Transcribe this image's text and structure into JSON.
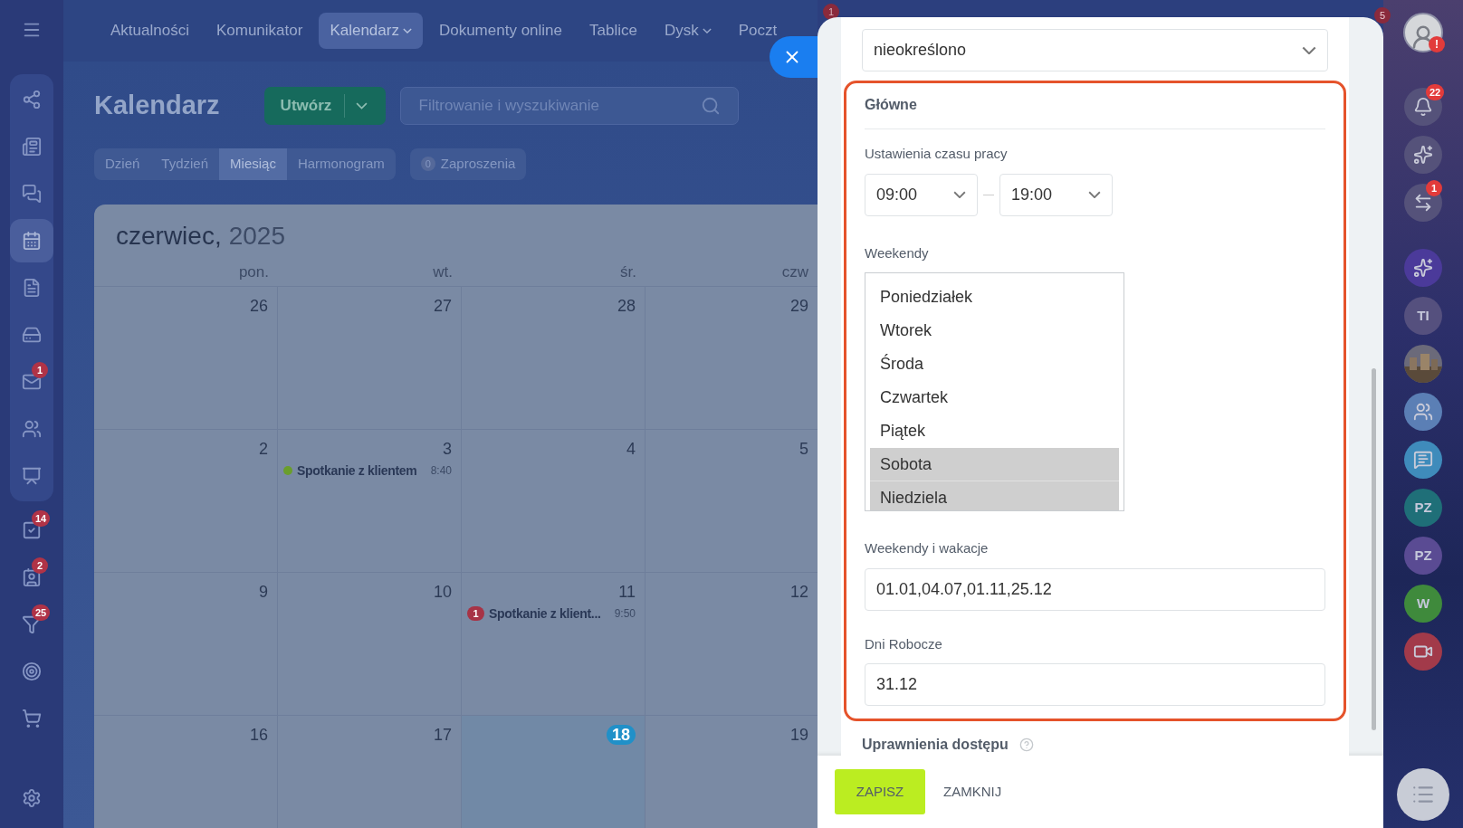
{
  "top_nav": {
    "items": [
      {
        "label": "Aktualności",
        "selected": false,
        "dropdown": false
      },
      {
        "label": "Komunikator",
        "selected": false,
        "dropdown": false
      },
      {
        "label": "Kalendarz",
        "selected": true,
        "dropdown": true
      },
      {
        "label": "Dokumenty online",
        "selected": false,
        "dropdown": false
      },
      {
        "label": "Tablice",
        "selected": false,
        "dropdown": false
      },
      {
        "label": "Dysk",
        "selected": false,
        "dropdown": true
      },
      {
        "label": "Poczt",
        "selected": false,
        "dropdown": false
      }
    ],
    "badges": [
      "1",
      "5"
    ]
  },
  "left_sidebar": {
    "group": [
      {
        "selected": false
      },
      {
        "selected": false
      },
      {
        "selected": false
      },
      {
        "selected": true
      },
      {
        "selected": false
      },
      {
        "selected": false
      },
      {
        "selected": false,
        "badge": "1"
      },
      {
        "selected": false
      },
      {
        "selected": false
      }
    ],
    "items": [
      {
        "selected": false,
        "badge": "14"
      },
      {
        "selected": false,
        "badge": "2"
      },
      {
        "selected": false,
        "badge": "25"
      },
      {
        "selected": false
      },
      {
        "selected": false
      }
    ]
  },
  "page": {
    "title": "Kalendarz",
    "create_button": "Utwórz",
    "search": {
      "placeholder": "Filtrowanie i wyszukiwanie"
    },
    "view_tabs": [
      {
        "label": "Dzień",
        "selected": false
      },
      {
        "label": "Tydzień",
        "selected": false
      },
      {
        "label": "Miesiąc",
        "selected": true
      },
      {
        "label": "Harmonogram",
        "selected": false
      }
    ],
    "invitations": {
      "count": "0",
      "label": "Zaproszenia"
    }
  },
  "calendar": {
    "month": "czerwiec,",
    "year": "2025",
    "weekdays": [
      "pon.",
      "wt.",
      "śr.",
      "czw"
    ],
    "weeks": [
      [
        {
          "day": "26",
          "today": false
        },
        {
          "day": "27",
          "today": false
        },
        {
          "day": "28",
          "today": false
        },
        {
          "day": "29",
          "today": false
        }
      ],
      [
        {
          "day": "2",
          "today": false
        },
        {
          "day": "3",
          "today": false,
          "events": [
            {
              "kind": "dot",
              "color": "#6a9e2c",
              "title": "Spotkanie z klientem",
              "time": "8:40"
            }
          ]
        },
        {
          "day": "4",
          "today": false
        },
        {
          "day": "5",
          "today": false
        }
      ],
      [
        {
          "day": "9",
          "today": false
        },
        {
          "day": "10",
          "today": false
        },
        {
          "day": "11",
          "today": false,
          "events": [
            {
              "kind": "count",
              "count": "1",
              "title": "Spotkanie z klient...",
              "time": "9:50"
            }
          ]
        },
        {
          "day": "12",
          "today": false
        }
      ],
      [
        {
          "day": "16",
          "today": false
        },
        {
          "day": "17",
          "today": false
        },
        {
          "day": "18",
          "today": true
        },
        {
          "day": "19",
          "today": false
        }
      ]
    ]
  },
  "panel": {
    "type_select": "nieokreślono",
    "section_title": "Główne",
    "work_time": {
      "label": "Ustawienia czasu pracy",
      "from": "09:00",
      "to": "19:00"
    },
    "weekends": {
      "label": "Weekendy",
      "days": [
        {
          "label": "Poniedziałek",
          "selected": false
        },
        {
          "label": "Wtorek",
          "selected": false
        },
        {
          "label": "Środa",
          "selected": false
        },
        {
          "label": "Czwartek",
          "selected": false
        },
        {
          "label": "Piątek",
          "selected": false
        },
        {
          "label": "Sobota",
          "selected": true
        },
        {
          "label": "Niedziela",
          "selected": true
        }
      ]
    },
    "holidays": {
      "label": "Weekendy i wakacje",
      "value": "01.01,04.07,01.11,25.12"
    },
    "workdays": {
      "label": "Dni Robocze",
      "value": "31.12"
    },
    "access_title": "Uprawnienia dostępu",
    "buttons": [
      "ZAPISZ",
      "ZAMKNIJ"
    ]
  },
  "right_bar": {
    "items": [
      {
        "kind": "avatar",
        "badge": "!"
      },
      {
        "kind": "icon",
        "badge": "22"
      },
      {
        "kind": "icon"
      },
      {
        "kind": "icon",
        "badge": "1"
      },
      {
        "kind": "icon",
        "color": "#4b3a9a"
      },
      {
        "kind": "initials",
        "text": "TI",
        "color": "#55507e"
      },
      {
        "kind": "picture"
      },
      {
        "kind": "icon",
        "color": "#5b7fb5"
      },
      {
        "kind": "icon",
        "color": "#3f8bbb"
      },
      {
        "kind": "initials",
        "text": "PZ",
        "color": "#1f6f78"
      },
      {
        "kind": "initials",
        "text": "PZ",
        "color": "#5a4b93"
      },
      {
        "kind": "initials",
        "text": "W",
        "color": "#3f8a3c"
      },
      {
        "kind": "icon",
        "color": "#a23a4a"
      }
    ]
  }
}
